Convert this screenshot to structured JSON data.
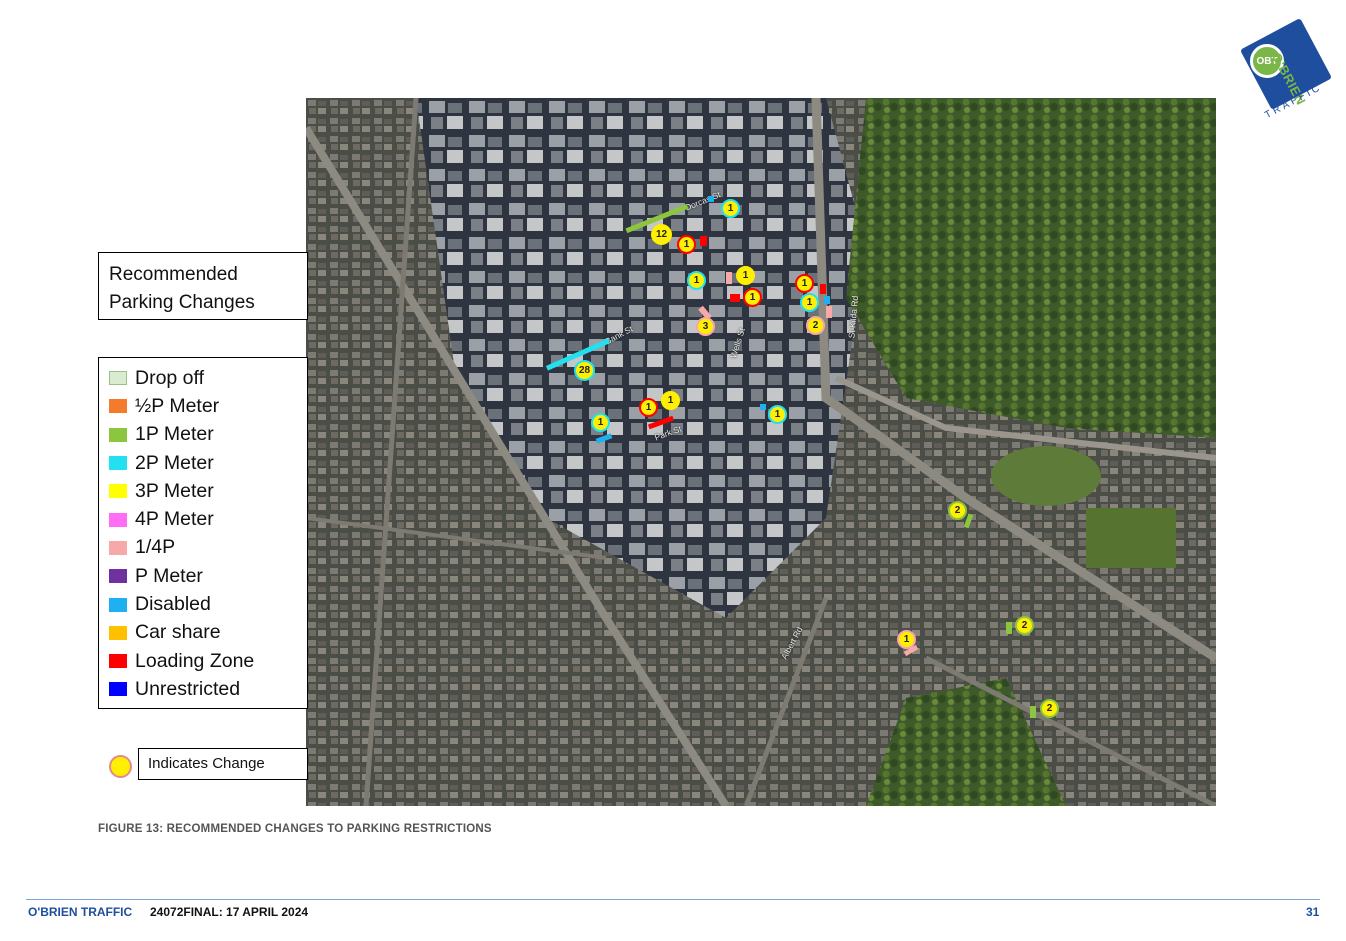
{
  "logo": {
    "badge": "OBT",
    "name": "O'BRIEN",
    "sub": "TRAFFIC"
  },
  "title_box": {
    "line1": "Recommended",
    "line2": "Parking Changes"
  },
  "legend": {
    "items": [
      {
        "label": "Drop off",
        "color": "#d9ecd0"
      },
      {
        "label": "½P Meter",
        "color": "#f47a2c"
      },
      {
        "label": "1P Meter",
        "color": "#8cc63f"
      },
      {
        "label": "2P Meter",
        "color": "#22e0f0"
      },
      {
        "label": "3P Meter",
        "color": "#ffff00"
      },
      {
        "label": "4P Meter",
        "color": "#ff6cf5"
      },
      {
        "label": "1/4P",
        "color": "#f7a8a8"
      },
      {
        "label": "P Meter",
        "color": "#7030a0"
      },
      {
        "label": "Disabled",
        "color": "#1fb0f0"
      },
      {
        "label": "Car share",
        "color": "#ffc000"
      },
      {
        "label": "Loading Zone",
        "color": "#ff0000"
      },
      {
        "label": "Unrestricted",
        "color": "#0000ff"
      }
    ]
  },
  "change_note": {
    "label": "Indicates Change",
    "icon": "yellow-circle-icon"
  },
  "map": {
    "street_labels": [
      "Dorcas St",
      "Bank St",
      "Wells St",
      "St Kilda Rd",
      "Park St",
      "Albert Rd"
    ],
    "markers": [
      {
        "value": "1",
        "border": "cyan"
      },
      {
        "value": "12",
        "border": "yellow"
      },
      {
        "value": "1",
        "border": "red"
      },
      {
        "value": "1",
        "border": "cyan"
      },
      {
        "value": "1",
        "border": "yellow"
      },
      {
        "value": "1",
        "border": "red"
      },
      {
        "value": "1",
        "border": "red"
      },
      {
        "value": "1",
        "border": "cyan"
      },
      {
        "value": "3",
        "border": "pink"
      },
      {
        "value": "2",
        "border": "pink"
      },
      {
        "value": "28",
        "border": "cyan"
      },
      {
        "value": "1",
        "border": "red"
      },
      {
        "value": "1",
        "border": "yellow"
      },
      {
        "value": "1",
        "border": "cyan"
      },
      {
        "value": "1",
        "border": "cyan"
      },
      {
        "value": "2",
        "border": "green"
      },
      {
        "value": "2",
        "border": "green"
      },
      {
        "value": "1",
        "border": "pink"
      },
      {
        "value": "2",
        "border": "green"
      }
    ]
  },
  "caption": "FIGURE 13: RECOMMENDED CHANGES TO PARKING RESTRICTIONS",
  "footer": {
    "brand": "O'BRIEN TRAFFIC",
    "doc": "24072FINAL: 17 APRIL 2024",
    "page": "31"
  }
}
